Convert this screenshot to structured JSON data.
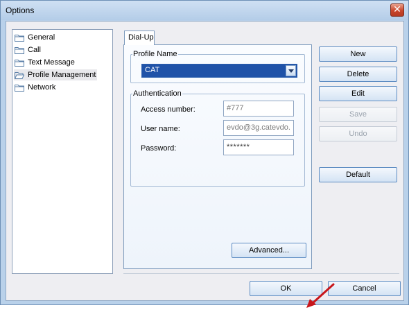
{
  "window": {
    "title": "Options",
    "close_glyph": "✕"
  },
  "tree": {
    "items": [
      {
        "label": "General",
        "icon": "folder-icon",
        "selected": false
      },
      {
        "label": "Call",
        "icon": "folder-icon",
        "selected": false
      },
      {
        "label": "Text Message",
        "icon": "folder-icon",
        "selected": false
      },
      {
        "label": "Profile Management",
        "icon": "folder-open-icon",
        "selected": true
      },
      {
        "label": "Network",
        "icon": "folder-icon",
        "selected": false
      }
    ]
  },
  "tab": {
    "label": "Dial-Up"
  },
  "profile": {
    "group_label": "Profile Name",
    "selected": "CAT"
  },
  "auth": {
    "group_label": "Authentication",
    "access_label": "Access number:",
    "access_value": "#777",
    "user_label": "User name:",
    "user_value": "evdo@3g.catevdo.",
    "password_label": "Password:",
    "password_value": "*******"
  },
  "buttons": {
    "new": "New",
    "delete": "Delete",
    "edit": "Edit",
    "save": "Save",
    "undo": "Undo",
    "default": "Default",
    "advanced": "Advanced...",
    "ok": "OK",
    "cancel": "Cancel"
  },
  "colors": {
    "selection": "#1f52a8",
    "arrow": "#c8161b",
    "button_border": "#5c8bc2"
  }
}
